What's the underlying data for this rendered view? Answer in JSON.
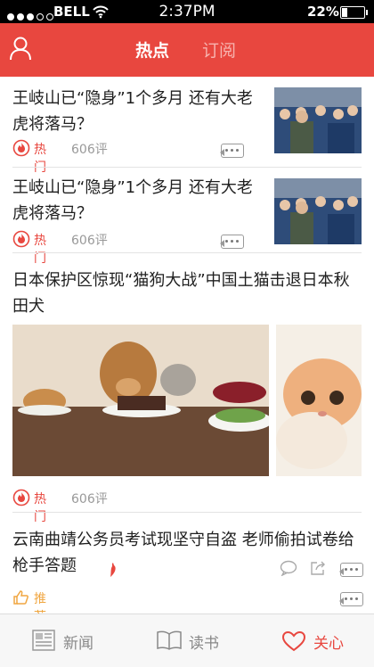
{
  "status_bar": {
    "carrier": "BELL",
    "time": "2:37PM",
    "battery": "22%"
  },
  "nav": {
    "tabs": [
      "热点",
      "订阅"
    ]
  },
  "articles": [
    {
      "title": "王岐山已“隐身”1个多月 还有大老虎将落马？",
      "tag": "热门",
      "comments": "606评"
    },
    {
      "title": "王岐山已“隐身”1个多月 还有大老虎将落马？",
      "tag": "热门",
      "comments": "606评"
    },
    {
      "title": "日本保护区惊现“猫狗大战”中国土猫击退日本秋田犬",
      "tag": "热门",
      "comments": "606评"
    },
    {
      "title": "云南曲靖公务员考试现坚守自盗 老师偷拍试卷给枪手答题",
      "tag": "推荐"
    }
  ],
  "tab_bar": {
    "items": [
      "新闻",
      "读书",
      "关心"
    ]
  },
  "colors": {
    "accent": "#e8473f",
    "text": "#1f1f1f",
    "muted": "#999999"
  }
}
